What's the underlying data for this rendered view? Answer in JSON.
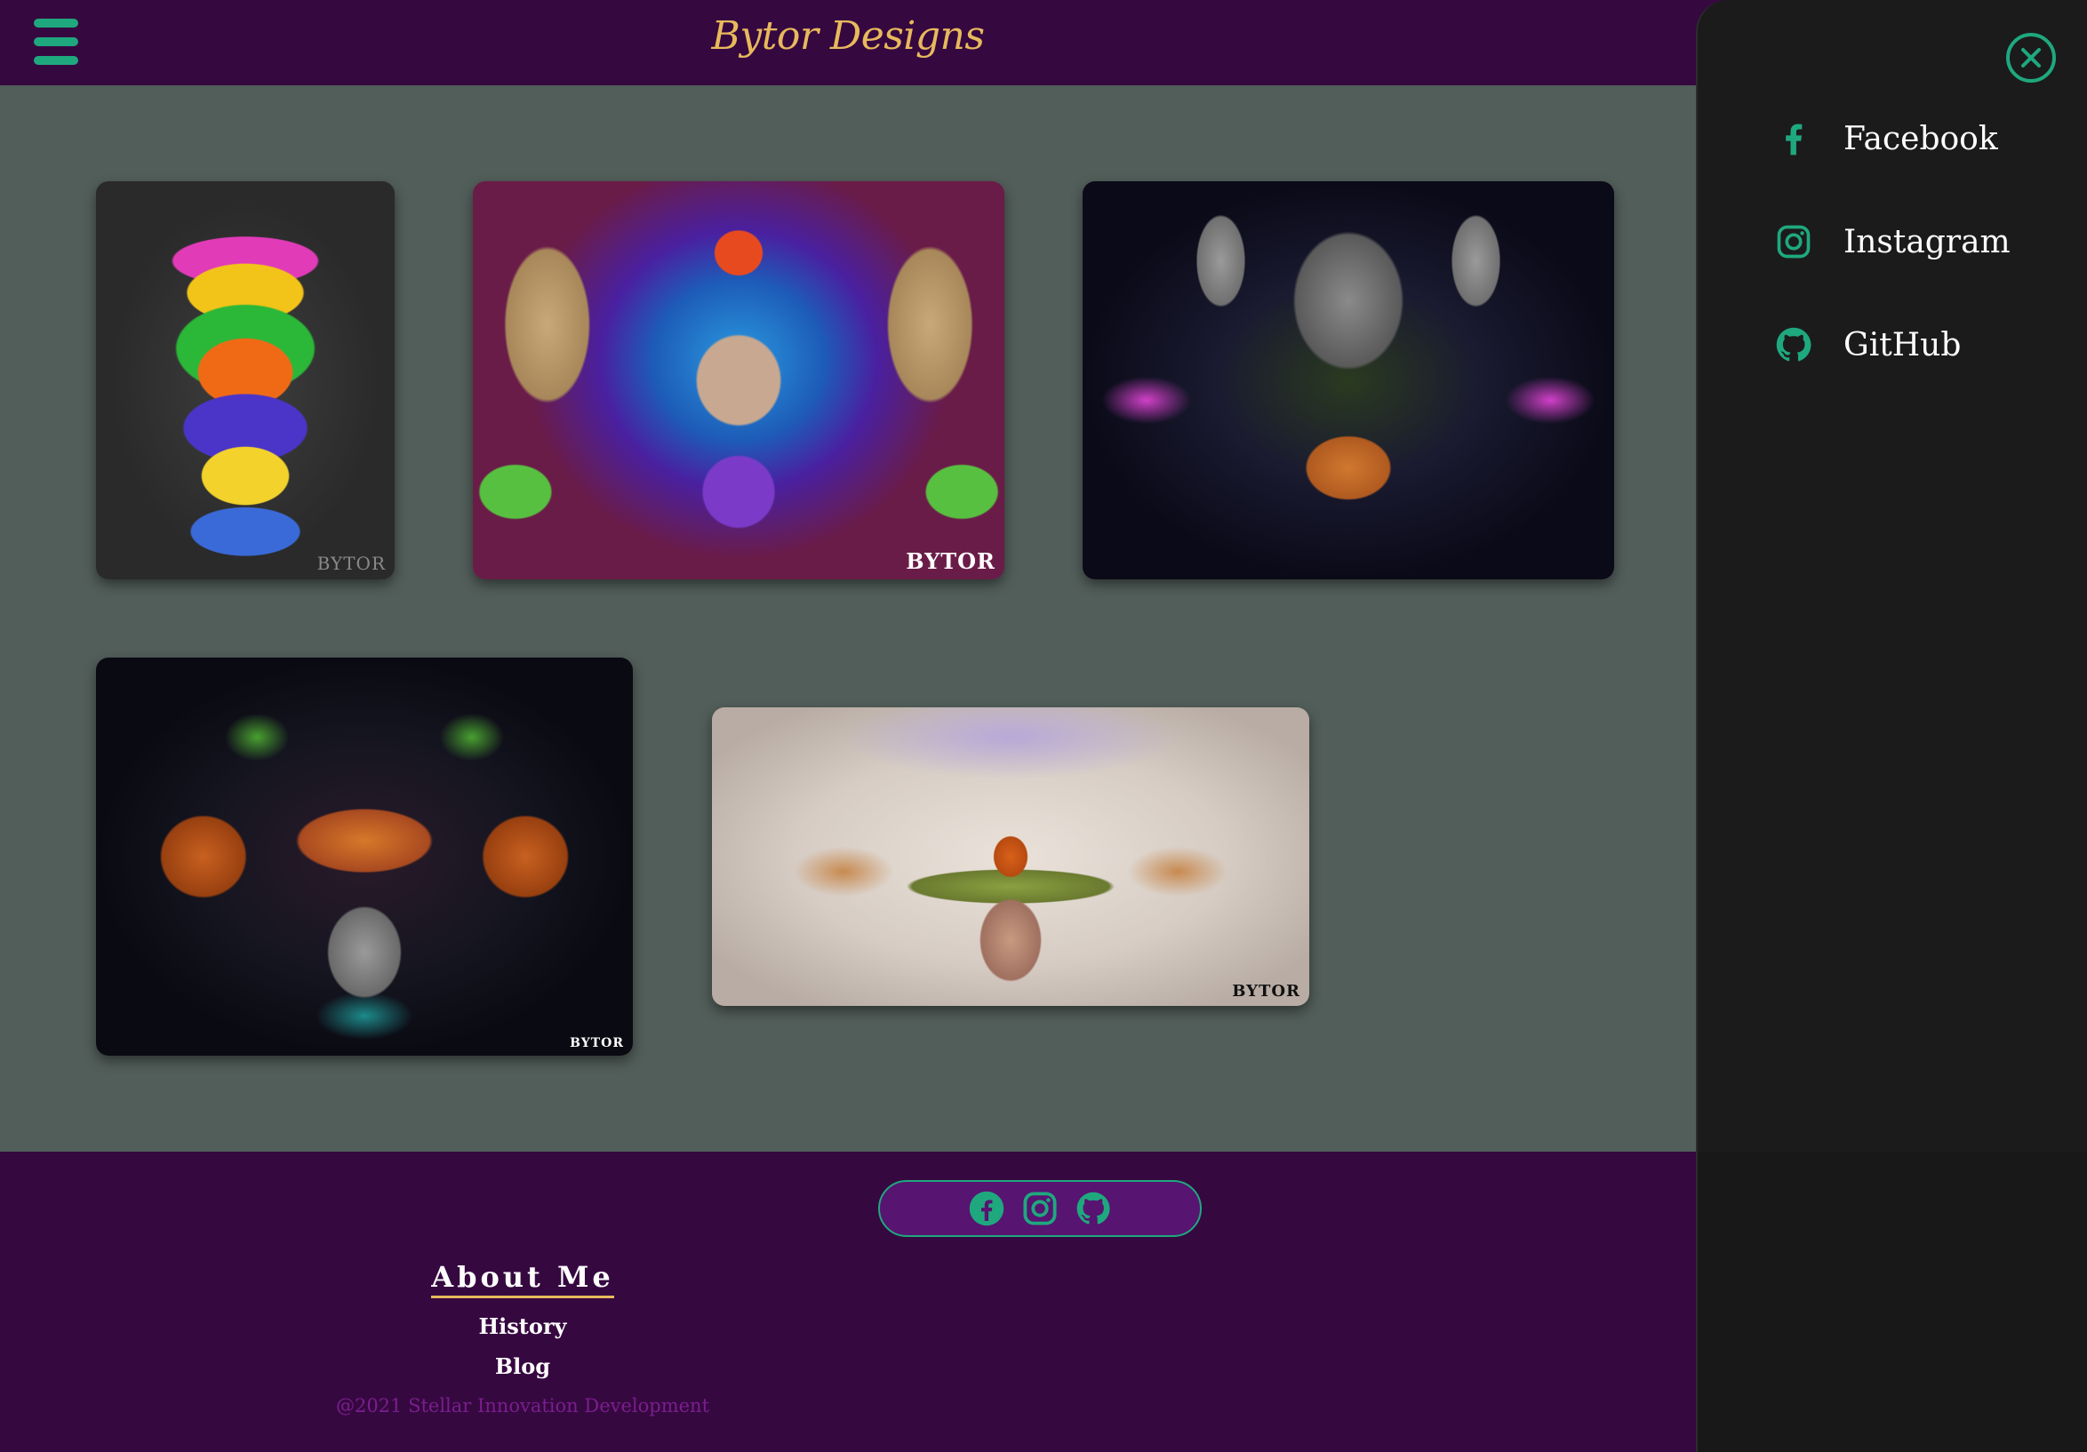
{
  "header": {
    "title": "Bytor Designs",
    "menu_icon": "hamburger-menu-icon"
  },
  "gallery": {
    "artworks": [
      {
        "name": "rainbow-birds-flowers-mirror",
        "watermark": "BYTOR"
      },
      {
        "name": "psychedelic-temple-mandala",
        "watermark": "BYTOR"
      },
      {
        "name": "mirrored-faces-light-burst",
        "watermark": ""
      },
      {
        "name": "frogs-snakes-face-crown",
        "watermark": "BYTOR"
      },
      {
        "name": "mushroom-crown-woman",
        "watermark": "BYTOR"
      }
    ]
  },
  "footer": {
    "social_icons": [
      "facebook-icon",
      "instagram-icon",
      "github-icon"
    ],
    "about_title": "About Me",
    "links": {
      "history": "History",
      "blog": "Blog"
    },
    "copyright": "@2021 Stellar Innovation Development"
  },
  "drawer": {
    "close_icon": "close-icon",
    "items": [
      {
        "label": "Facebook",
        "icon": "facebook-icon"
      },
      {
        "label": "Instagram",
        "icon": "instagram-icon"
      },
      {
        "label": "GitHub",
        "icon": "github-icon"
      }
    ]
  },
  "colors": {
    "header_bg": "#360840",
    "gallery_bg": "#525e5a",
    "accent_green": "#1fa87e",
    "title_gold": "#e8b95c",
    "drawer_bg": "#1b1b1b",
    "copyright_purple": "#7a1e8e"
  }
}
